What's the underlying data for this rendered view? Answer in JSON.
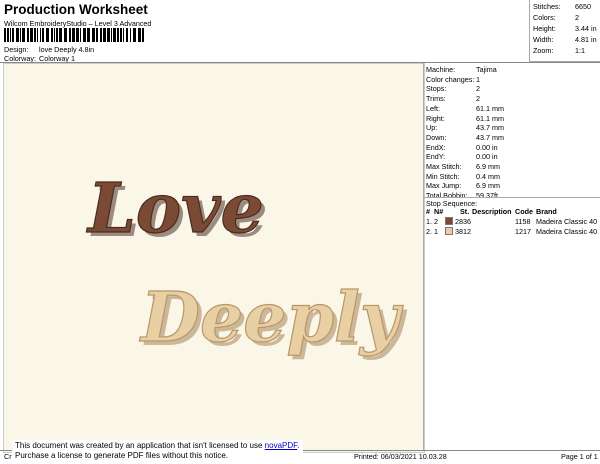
{
  "header": {
    "title": "Production Worksheet",
    "subtitle": "Wilcom EmbroideryStudio – Level 3 Advanced",
    "design_label": "Design:",
    "design_value": "love Deeply 4.8in",
    "colorway_label": "Colorway:",
    "colorway_value": "Colorway 1"
  },
  "summary": {
    "stitches_label": "Stitches:",
    "stitches": "6650",
    "colors_label": "Colors:",
    "colors": "2",
    "height_label": "Height:",
    "height": "3.44 in",
    "width_label": "Width:",
    "width": "4.81 in",
    "zoom_label": "Zoom:",
    "zoom": "1:1"
  },
  "design": {
    "line1": "Love",
    "line2": "Deeply",
    "color1": "#7a4a35",
    "color2": "#e8cfa4"
  },
  "info": [
    {
      "k": "Machine:",
      "v": "Tajima"
    },
    {
      "k": "Color changes:",
      "v": "1"
    },
    {
      "k": "Stops:",
      "v": "2"
    },
    {
      "k": "Trims:",
      "v": "2"
    },
    {
      "k": "Left:",
      "v": "61.1 mm"
    },
    {
      "k": "Right:",
      "v": "61.1 mm"
    },
    {
      "k": "Up:",
      "v": "43.7 mm"
    },
    {
      "k": "Down:",
      "v": "43.7 mm"
    },
    {
      "k": "EndX:",
      "v": "0.00 in"
    },
    {
      "k": "EndY:",
      "v": "0.00 in"
    },
    {
      "k": "Max Stitch:",
      "v": "6.9 mm"
    },
    {
      "k": "Min Stitch:",
      "v": "0.4 mm"
    },
    {
      "k": "Max Jump:",
      "v": "6.9 mm"
    },
    {
      "k": "Total Bobbin:",
      "v": "59.37ft"
    }
  ],
  "stop_sequence": {
    "title": "Stop Sequence:",
    "columns": [
      "#",
      "N#",
      "St.",
      "Description",
      "Code",
      "Brand"
    ],
    "rows": [
      {
        "num": "1.",
        "n": "2",
        "swatch": "#7a4a35",
        "st": "2836",
        "desc": "",
        "code": "1158",
        "brand": "Madeira Classic 40"
      },
      {
        "num": "2.",
        "n": "1",
        "swatch": "#eec8a8",
        "st": "3812",
        "desc": "",
        "code": "1217",
        "brand": "Madeira Classic 40"
      }
    ]
  },
  "footer": {
    "notice_line1": "This document was created by an application that isn't licensed to use ",
    "notice_link": "novaPDF",
    "notice_line1_end": ".",
    "notice_line2": "Purchase a license to generate PDF files without this notice.",
    "left_text": "Cr",
    "printed": "Printed: 06/03/2021 10.03.28",
    "page": "Page 1 of 1"
  }
}
